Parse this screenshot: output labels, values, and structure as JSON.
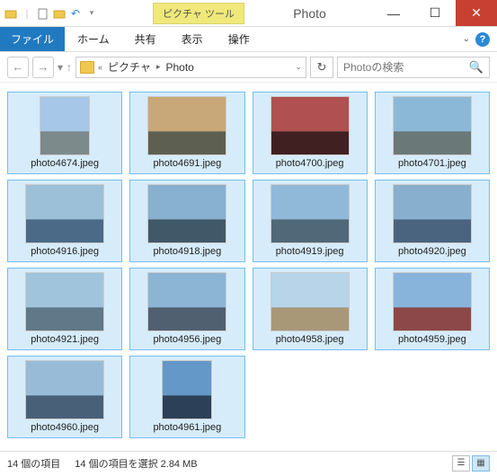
{
  "window": {
    "title": "Photo",
    "tool_tab": "ピクチャ ツール"
  },
  "ribbon": {
    "file": "ファイル",
    "tabs": [
      "ホーム",
      "共有",
      "表示",
      "操作"
    ]
  },
  "address": {
    "segments": [
      "ピクチャ",
      "Photo"
    ]
  },
  "search": {
    "placeholder": "Photoの検索"
  },
  "files": [
    {
      "name": "photo4674.jpeg",
      "orient": "portrait",
      "sky": "#a6c7e8",
      "ground": "#7c8a8c"
    },
    {
      "name": "photo4691.jpeg",
      "orient": "landscape",
      "sky": "#c8a878",
      "ground": "#5d6050"
    },
    {
      "name": "photo4700.jpeg",
      "orient": "landscape",
      "sky": "#b05050",
      "ground": "#402020"
    },
    {
      "name": "photo4701.jpeg",
      "orient": "landscape",
      "sky": "#8cb8d8",
      "ground": "#6b7878"
    },
    {
      "name": "photo4916.jpeg",
      "orient": "landscape",
      "sky": "#9cc0d8",
      "ground": "#4a6a88"
    },
    {
      "name": "photo4918.jpeg",
      "orient": "landscape",
      "sky": "#88b0d0",
      "ground": "#405868"
    },
    {
      "name": "photo4919.jpeg",
      "orient": "landscape",
      "sky": "#90b8d8",
      "ground": "#506878"
    },
    {
      "name": "photo4920.jpeg",
      "orient": "landscape",
      "sky": "#88b0ce",
      "ground": "#4a6480"
    },
    {
      "name": "photo4921.jpeg",
      "orient": "landscape",
      "sky": "#a0c4dc",
      "ground": "#607888"
    },
    {
      "name": "photo4956.jpeg",
      "orient": "landscape",
      "sky": "#8cb4d4",
      "ground": "#506070"
    },
    {
      "name": "photo4958.jpeg",
      "orient": "landscape",
      "sky": "#b8d4e8",
      "ground": "#a89878"
    },
    {
      "name": "photo4959.jpeg",
      "orient": "landscape",
      "sky": "#88b4dc",
      "ground": "#8c4848"
    },
    {
      "name": "photo4960.jpeg",
      "orient": "landscape",
      "sky": "#98bcd8",
      "ground": "#486078"
    },
    {
      "name": "photo4961.jpeg",
      "orient": "portrait",
      "sky": "#6498c8",
      "ground": "#2c4058"
    }
  ],
  "status": {
    "count_label": "14 個の項目",
    "select_label": "14 個の項目を選択 2.84 MB"
  }
}
